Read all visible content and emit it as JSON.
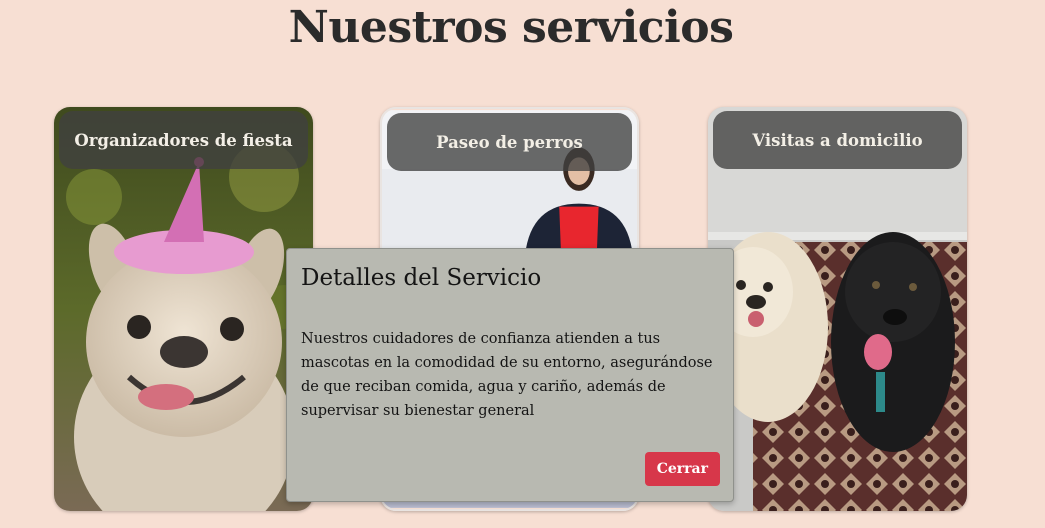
{
  "page": {
    "title": "Nuestros servicios"
  },
  "cards": [
    {
      "label": "Organizadores de fiesta",
      "image": "french-bulldog-party-hat-photo"
    },
    {
      "label": "Paseo de perros",
      "image": "dog-walker-woman-photo"
    },
    {
      "label": "Visitas a domicilio",
      "image": "two-dogs-on-rug-photo"
    }
  ],
  "modal": {
    "title": "Detalles del Servicio",
    "body": "Nuestros cuidadores de confianza atienden a tus mascotas en la comodidad de su entorno, asegurándose de que reciban comida, agua y cariño, además de supervisar su bienestar general",
    "close_label": "Cerrar"
  },
  "colors": {
    "background": "#f7dfd3",
    "modal": "#b8b9b1",
    "close_button": "#d7374a"
  }
}
